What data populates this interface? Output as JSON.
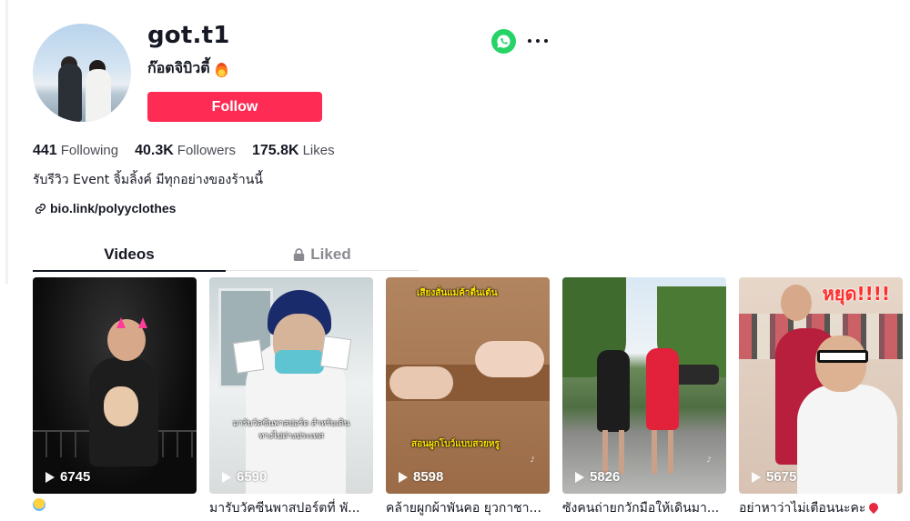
{
  "profile": {
    "username": "got.t1",
    "display_name": "ก๊อตจิบิวตี้",
    "follow_label": "Follow",
    "bio": "รับรีวิว Event จิ้มลิ้งค์ มีทุกอย่างของร้านนี้",
    "link": "bio.link/polyyclothes"
  },
  "stats": {
    "following_value": "441",
    "following_label": "Following",
    "followers_value": "40.3K",
    "followers_label": "Followers",
    "likes_value": "175.8K",
    "likes_label": "Likes"
  },
  "tabs": {
    "videos": "Videos",
    "liked": "Liked"
  },
  "videos": [
    {
      "views": "6745",
      "caption": ""
    },
    {
      "views": "6590",
      "caption": "มารับวัคซีนพาสปอร์ตที่ พั...",
      "overlay": "มารับวัคซีนพาสปอร์ต สำหรับเดินทางไปต่างประเทศ"
    },
    {
      "views": "8598",
      "caption": "คล้ายผูกผ้าพันคอ ยุวกาชา...",
      "overlay_top": "เสียงสั่นแม่ค้าตื่นเต้น",
      "overlay_mid": "สอนผูกโบว์แบบสวยหรู"
    },
    {
      "views": "5826",
      "caption": "ซังคนถ่ายกวักมือให้เดินมา..."
    },
    {
      "views": "5675",
      "caption": "อย่าหาว่าไม่เตือนนะคะ",
      "overlay_top": "หยุด!!!!"
    }
  ],
  "colors": {
    "follow": "#fe2c55",
    "whatsapp": "#25d366",
    "text": "#161823"
  },
  "icons": [
    "whatsapp-icon",
    "more-icon",
    "link-icon",
    "lock-icon",
    "play-icon",
    "fire-emoji",
    "pin-emoji"
  ]
}
